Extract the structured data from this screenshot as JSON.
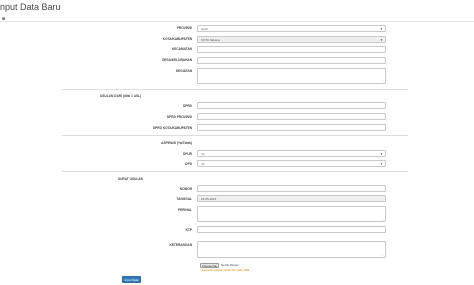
{
  "page": {
    "title": "nput Data Baru"
  },
  "location": {
    "provinsi_label": "PROVINSI",
    "provinsi_value": "Aceh",
    "kota_label": "KOTA/KABUPATEN",
    "kota_value": "KOTA Sabang",
    "kecamatan_label": "KECAMATAN",
    "kecamatan_value": "",
    "desa_label": "DESA/KELURAHAN",
    "desa_value": "",
    "kegiatan_label": "KEGIATAN",
    "kegiatan_value": ""
  },
  "usulan": {
    "section_label": "USULAN DARI (diisi 1 ASL)",
    "dprd_label": "DPRD",
    "dprd_value": "",
    "dprd_prov_label": "DPRD PROVINSI",
    "dprd_prov_value": "",
    "dprd_kota_label": "DPRD KOTA/KABUPATEN",
    "dprd_kota_value": ""
  },
  "aspirasi": {
    "section_label": "ASPIRASI (Ya/Tidak)",
    "dpu_label": "DPUR",
    "dpu_value": "Ya",
    "dpd_label": "DPD",
    "dpd_value": "Ya"
  },
  "surat": {
    "section_label": "SURAT USULAN",
    "nomor_label": "NOMOR",
    "nomor_value": "",
    "tanggal_label": "TANGGAL",
    "tanggal_value": "15-05-2015",
    "perihal_label": "PERIHAL",
    "perihal_value": "",
    "ktp_label": "KTP",
    "ktp_value": "",
    "keterangan_label": "KETERANGAN",
    "keterangan_value": "",
    "file_button": "Choose File",
    "file_status": "No file chosen",
    "file_hint": "* hanya file gambar, ukuran file maks: 2MB"
  },
  "actions": {
    "submit_label": "Input Data"
  },
  "colors": {
    "primary": "#337ab7",
    "hint": "#e07b00"
  },
  "icons": {
    "home": "home-icon",
    "dropdown": "caret-down-icon"
  }
}
